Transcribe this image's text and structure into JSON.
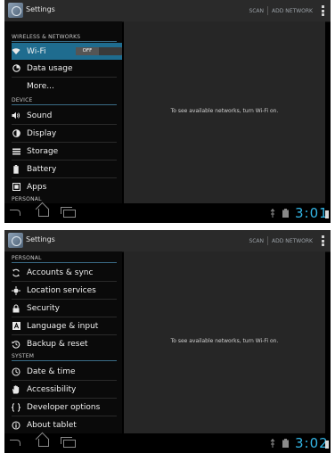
{
  "screens": [
    {
      "title": "Settings",
      "actions": [
        "SCAN",
        "ADD NETWORK"
      ],
      "detail_message": "To see available networks, turn Wi-Fi on.",
      "clock": "3:01",
      "headers": [
        "WIRELESS & NETWORKS",
        "DEVICE",
        "PERSONAL"
      ],
      "items": [
        {
          "label": "Wi-Fi",
          "icon": "wifi-icon",
          "toggle": "OFF"
        },
        {
          "label": "Data usage",
          "icon": "data-usage-icon"
        },
        {
          "label": "More...",
          "icon": ""
        },
        {
          "label": "Sound",
          "icon": "speaker-icon"
        },
        {
          "label": "Display",
          "icon": "display-icon"
        },
        {
          "label": "Storage",
          "icon": "storage-icon"
        },
        {
          "label": "Battery",
          "icon": "battery-icon"
        },
        {
          "label": "Apps",
          "icon": "apps-icon"
        }
      ]
    },
    {
      "title": "Settings",
      "actions": [
        "SCAN",
        "ADD NETWORK"
      ],
      "detail_message": "To see available networks, turn Wi-Fi on.",
      "clock": "3:02",
      "headers": [
        "PERSONAL",
        "SYSTEM"
      ],
      "items": [
        {
          "label": "Accounts & sync",
          "icon": "sync-icon"
        },
        {
          "label": "Location services",
          "icon": "location-icon"
        },
        {
          "label": "Security",
          "icon": "lock-icon"
        },
        {
          "label": "Language & input",
          "icon": "language-icon"
        },
        {
          "label": "Backup & reset",
          "icon": "backup-icon"
        },
        {
          "label": "Date & time",
          "icon": "clock-icon"
        },
        {
          "label": "Accessibility",
          "icon": "hand-icon"
        },
        {
          "label": "Developer options",
          "icon": "braces-icon"
        },
        {
          "label": "About tablet",
          "icon": "info-icon"
        }
      ]
    }
  ],
  "colors": {
    "accent": "#33b5e5",
    "selected": "#1f6c8f",
    "detail_bg": "#262626"
  }
}
